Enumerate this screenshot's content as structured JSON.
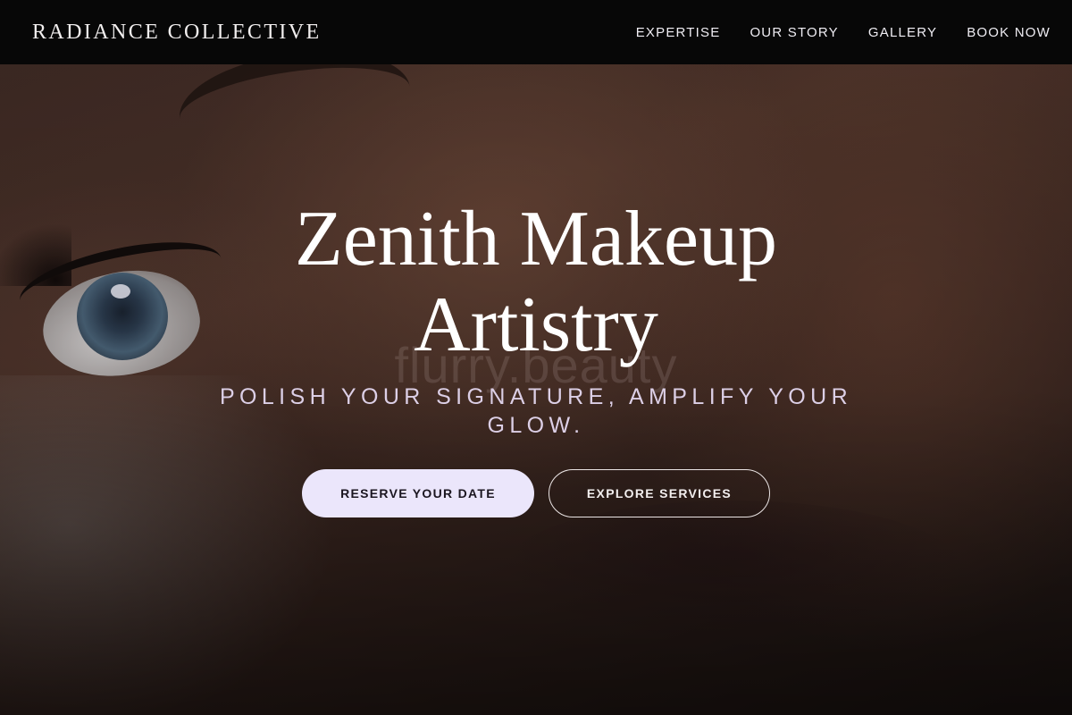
{
  "header": {
    "brand": "RADIANCE COLLECTIVE",
    "nav": [
      {
        "label": "EXPERTISE"
      },
      {
        "label": "OUR STORY"
      },
      {
        "label": "GALLERY"
      },
      {
        "label": "BOOK NOW"
      }
    ]
  },
  "hero": {
    "title_line1": "Zenith Makeup",
    "title_line2": "Artistry",
    "subtitle_line1": "POLISH YOUR SIGNATURE, AMPLIFY YOUR",
    "subtitle_line2": "GLOW.",
    "watermark": "flurry.beauty",
    "primary_cta": "RESERVE YOUR DATE",
    "secondary_cta": "EXPLORE SERVICES"
  },
  "colors": {
    "nav_background": "#070707",
    "primary_button": "#ebe6fb",
    "subtitle": "#dccfe6"
  }
}
